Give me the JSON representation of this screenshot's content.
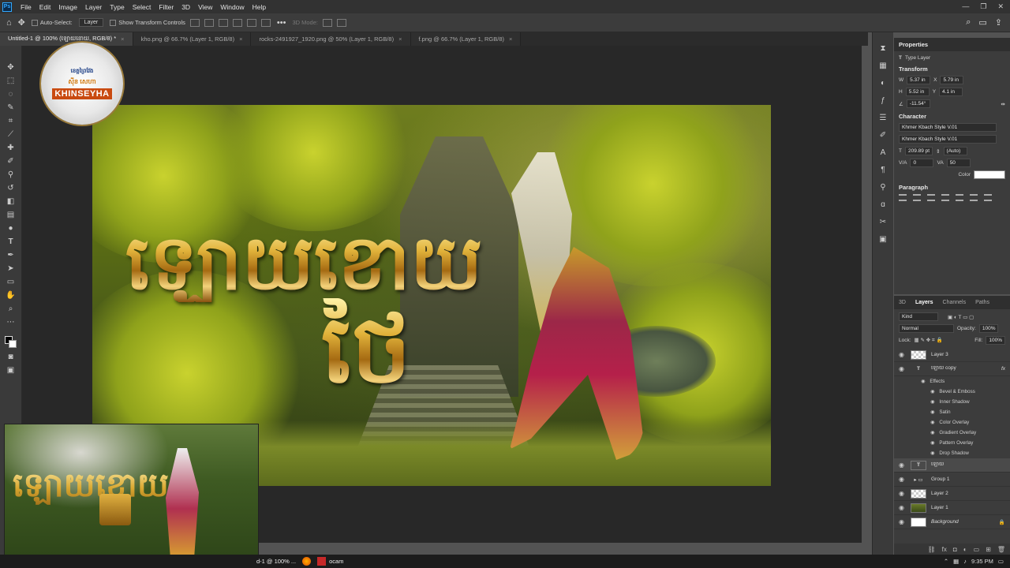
{
  "menu": [
    "File",
    "Edit",
    "Image",
    "Layer",
    "Type",
    "Select",
    "Filter",
    "3D",
    "View",
    "Window",
    "Help"
  ],
  "options": {
    "auto_select": "Auto-Select:",
    "target": "Layer",
    "show_transform": "Show Transform Controls",
    "mode_3d": "3D Mode:"
  },
  "tabs": [
    "Untitled-1 @ 100% (ឡោយខោយ, RGB/8) *",
    "kho.png @ 66.7% (Layer 1, RGB/8)",
    "rocks-2491927_1920.png @ 50% (Layer 1, RGB/8)",
    "f.png @ 66.7% (Layer 1, RGB/8)"
  ],
  "logo": {
    "line1": "ខេត្តព្រៃវែង",
    "line2": "ស៊ីន សេហា",
    "line3": "KHINSEYHA"
  },
  "artwork": {
    "title_line1": "ឡោយខោយ",
    "title_line2": "ថៃ"
  },
  "properties": {
    "title": "Properties",
    "type": "Type Layer",
    "transform": {
      "label": "Transform",
      "w": "5.37 in",
      "h": "5.52 in",
      "x": "5.79 in",
      "y": "4.1 in",
      "angle": "-11.54°"
    },
    "character": {
      "label": "Character",
      "font1": "Khmer Kbach Style V.01",
      "font2": "Khmer Kbach Style V.01",
      "size": "209.89 pt",
      "leading": "(Auto)",
      "tracking": "0",
      "kerning": "50",
      "color_label": "Color",
      "color": "#ffffff"
    },
    "paragraph": {
      "label": "Paragraph"
    }
  },
  "layers_panel": {
    "tabs": [
      "3D",
      "Layers",
      "Channels",
      "Paths"
    ],
    "kind": "Kind",
    "blend": "Normal",
    "opacity_label": "Opacity:",
    "opacity": "100%",
    "lock_label": "Lock:",
    "fill_label": "Fill:",
    "fill": "100%",
    "layers": [
      {
        "name": "Layer 3",
        "thumb": "check"
      },
      {
        "name": "ឡោយ copy",
        "thumb": "type",
        "fx": true
      },
      {
        "name": "Effects",
        "effect_header": true
      },
      {
        "name": "Bevel & Emboss",
        "effect": true
      },
      {
        "name": "Inner Shadow",
        "effect": true
      },
      {
        "name": "Satin",
        "effect": true
      },
      {
        "name": "Color Overlay",
        "effect": true
      },
      {
        "name": "Gradient Overlay",
        "effect": true
      },
      {
        "name": "Pattern Overlay",
        "effect": true
      },
      {
        "name": "Drop Shadow",
        "effect": true
      },
      {
        "name": "ឡោយ",
        "thumb": "type",
        "selected": true
      },
      {
        "name": "Group 1",
        "thumb": "folder"
      },
      {
        "name": "Layer 2",
        "thumb": "check"
      },
      {
        "name": "Layer 1",
        "thumb": "pic"
      },
      {
        "name": "Background",
        "thumb": "white"
      }
    ]
  },
  "taskbar": {
    "item1": "d-1 @ 100% ...",
    "item2": "ocam",
    "time": "9:35 PM"
  }
}
